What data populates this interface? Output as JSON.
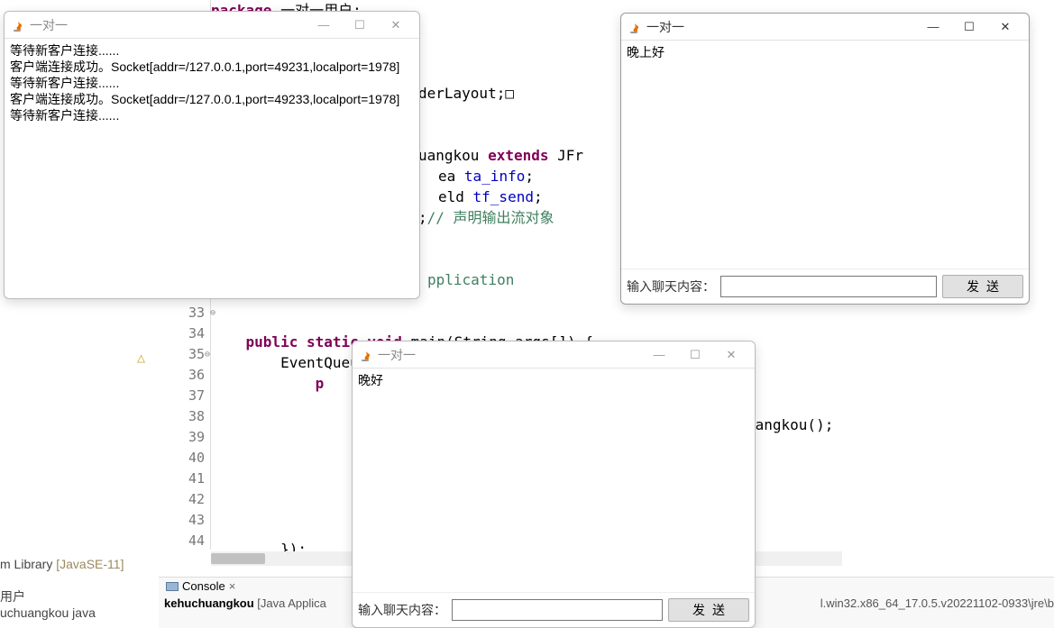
{
  "editor": {
    "package_line": "package",
    "package_rest": " 一对一用户;",
    "line5": {
      "p1": "derLayout;",
      "box": "□"
    },
    "line8": {
      "p1": "uangkou ",
      "kw": "extends",
      "p2": " JFr"
    },
    "line9": {
      "p1": "ea ",
      "ident": "ta_info",
      "p2": ";"
    },
    "line10": {
      "p1": "eld ",
      "ident": "tf_send",
      "p2": ";"
    },
    "line11": {
      "p1": ";",
      "cmt_prefix": "// ",
      "cmt": "声明输出流对象"
    },
    "line14": "pplication",
    "lines": [
      {
        "n": "33",
        "code": "public static void main(String args[]) {",
        "indent": 1
      },
      {
        "n": "34",
        "code": "EventQueue.invokeLater(new Runnable() {",
        "indent": 2
      },
      {
        "n": "35",
        "code": "p",
        "indent": 3,
        "fold": true
      },
      {
        "n": "36",
        "code": "",
        "indent": 3
      },
      {
        "n": "37",
        "code": "uangkou();",
        "right": true
      },
      {
        "n": "38",
        "code": ""
      },
      {
        "n": "39",
        "code": ""
      },
      {
        "n": "40",
        "code": ""
      },
      {
        "n": "41",
        "code": ""
      },
      {
        "n": "42",
        "code": ""
      },
      {
        "n": "43",
        "code": ""
      },
      {
        "n": "44",
        "code": "});",
        "indent": 2
      }
    ]
  },
  "sidebar": {
    "lib": "m Library ",
    "javase": "[JavaSE-11]",
    "line2": "用户",
    "line3": "uchuangkou java"
  },
  "console": {
    "tab": "Console",
    "content_bold": "kehuchuangkou",
    "content_rest": " [Java Applica",
    "content_right": "l.win32.x86_64_17.0.5.v20221102-0933\\jre\\b"
  },
  "win1": {
    "title": "一对一",
    "body": "等待新客户连接......\n客户端连接成功。Socket[addr=/127.0.0.1,port=49231,localport=1978]\n等待新客户连接......\n客户端连接成功。Socket[addr=/127.0.0.1,port=49233,localport=1978]\n等待新客户连接......"
  },
  "win2": {
    "title": "一对一",
    "body": "晚上好",
    "label": "输入聊天内容：",
    "button": "发送"
  },
  "win3": {
    "title": "一对一",
    "body": "晚好",
    "label": "输入聊天内容：",
    "button": "发送"
  }
}
